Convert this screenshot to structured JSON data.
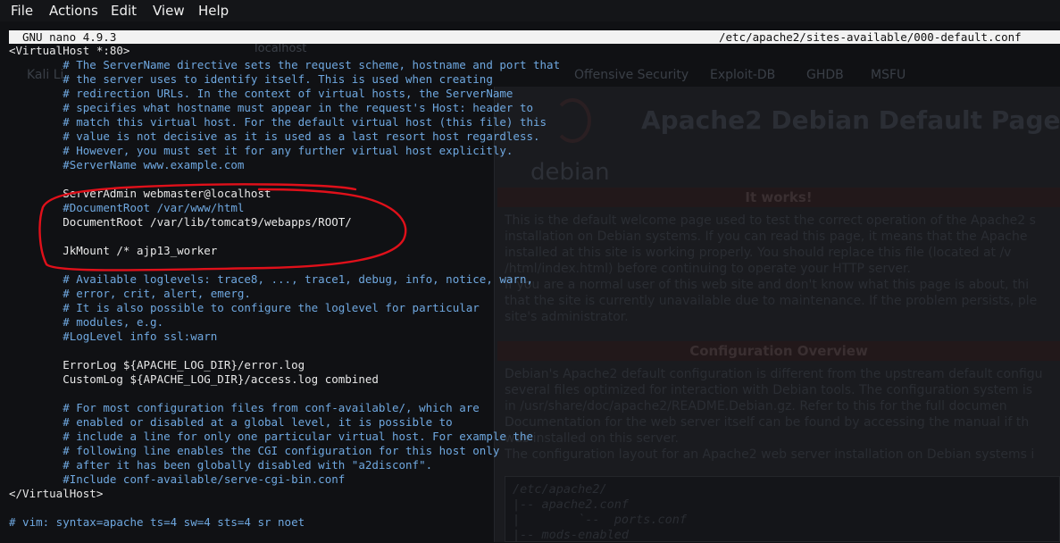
{
  "menu": [
    "File",
    "Actions",
    "Edit",
    "View",
    "Help"
  ],
  "nano": {
    "version": "GNU nano 4.9.3",
    "file_path": "/etc/apache2/sites-available/000-default.conf"
  },
  "colors": {
    "comment": "#6fa8e0",
    "text": "#e8e8e8",
    "annotation": "#e0101a",
    "background": "#101114"
  },
  "lines": [
    {
      "text": "<VirtualHost *:80>",
      "kind": "plain"
    },
    {
      "text": "        # The ServerName directive sets the request scheme, hostname and port that",
      "kind": "comment"
    },
    {
      "text": "        # the server uses to identify itself. This is used when creating",
      "kind": "comment"
    },
    {
      "text": "        # redirection URLs. In the context of virtual hosts, the ServerName",
      "kind": "comment"
    },
    {
      "text": "        # specifies what hostname must appear in the request's Host: header to",
      "kind": "comment"
    },
    {
      "text": "        # match this virtual host. For the default virtual host (this file) this",
      "kind": "comment"
    },
    {
      "text": "        # value is not decisive as it is used as a last resort host regardless.",
      "kind": "comment"
    },
    {
      "text": "        # However, you must set it for any further virtual host explicitly.",
      "kind": "comment"
    },
    {
      "text": "        #ServerName www.example.com",
      "kind": "comment"
    },
    {
      "text": "",
      "kind": "plain"
    },
    {
      "text": "        ServerAdmin webmaster@localhost",
      "kind": "plain"
    },
    {
      "text": "        #DocumentRoot /var/www/html",
      "kind": "comment"
    },
    {
      "text": "        DocumentRoot /var/lib/tomcat9/webapps/ROOT/",
      "kind": "plain"
    },
    {
      "text": "",
      "kind": "plain"
    },
    {
      "text": "        JkMount /* ajp13_worker",
      "kind": "plain"
    },
    {
      "text": "",
      "kind": "plain"
    },
    {
      "text": "        # Available loglevels: trace8, ..., trace1, debug, info, notice, warn,",
      "kind": "comment"
    },
    {
      "text": "        # error, crit, alert, emerg.",
      "kind": "comment"
    },
    {
      "text": "        # It is also possible to configure the loglevel for particular",
      "kind": "comment"
    },
    {
      "text": "        # modules, e.g.",
      "kind": "comment"
    },
    {
      "text": "        #LogLevel info ssl:warn",
      "kind": "comment"
    },
    {
      "text": "",
      "kind": "plain"
    },
    {
      "text": "        ErrorLog ${APACHE_LOG_DIR}/error.log",
      "kind": "plain"
    },
    {
      "text": "        CustomLog ${APACHE_LOG_DIR}/access.log combined",
      "kind": "plain"
    },
    {
      "text": "",
      "kind": "plain"
    },
    {
      "text": "        # For most configuration files from conf-available/, which are",
      "kind": "comment"
    },
    {
      "text": "        # enabled or disabled at a global level, it is possible to",
      "kind": "comment"
    },
    {
      "text": "        # include a line for only one particular virtual host. For example the",
      "kind": "comment"
    },
    {
      "text": "        # following line enables the CGI configuration for this host only",
      "kind": "comment"
    },
    {
      "text": "        # after it has been globally disabled with \"a2disconf\".",
      "kind": "comment"
    },
    {
      "text": "        #Include conf-available/serve-cgi-bin.conf",
      "kind": "comment"
    },
    {
      "text": "</VirtualHost>",
      "kind": "plain"
    },
    {
      "text": "",
      "kind": "plain"
    },
    {
      "text": "# vim: syntax=apache ts=4 sw=4 sts=4 sr noet",
      "kind": "comment"
    }
  ],
  "background_page": {
    "bookmarks": [
      "Kali Li",
      "Offensive Security",
      "Exploit-DB",
      "GHDB",
      "MSFU"
    ],
    "tab_label": "localhost",
    "heading": "Apache2 Debian Default Page",
    "logo_text": "debian",
    "section1": "It works!",
    "section2": "Configuration Overview",
    "para1": [
      "This is the default welcome page used to test the correct operation of the Apache2 s",
      "installation on Debian systems. If you can read this page, it means that the Apache",
      "installed at this site is working properly. You should replace this file (located at /v",
      "/html/index.html) before continuing to operate your HTTP server.",
      "If you are a normal user of this web site and don't know what this page is about, thi",
      "that the site is currently unavailable due to maintenance. If the problem persists, ple",
      "site's administrator."
    ],
    "para2": [
      "Debian's Apache2 default configuration is different from the upstream default configu",
      "several files optimized for interaction with Debian tools. The configuration system is",
      "in /usr/share/doc/apache2/README.Debian.gz. Refer to this for the full documen",
      "Documentation for the web server itself can be found by accessing the manual if th",
      "was installed on this server.",
      "The configuration layout for an Apache2 web server installation on Debian systems i"
    ],
    "code": [
      "/etc/apache2/",
      "|-- apache2.conf",
      "|        `--  ports.conf",
      "|-- mods-enabled"
    ]
  }
}
